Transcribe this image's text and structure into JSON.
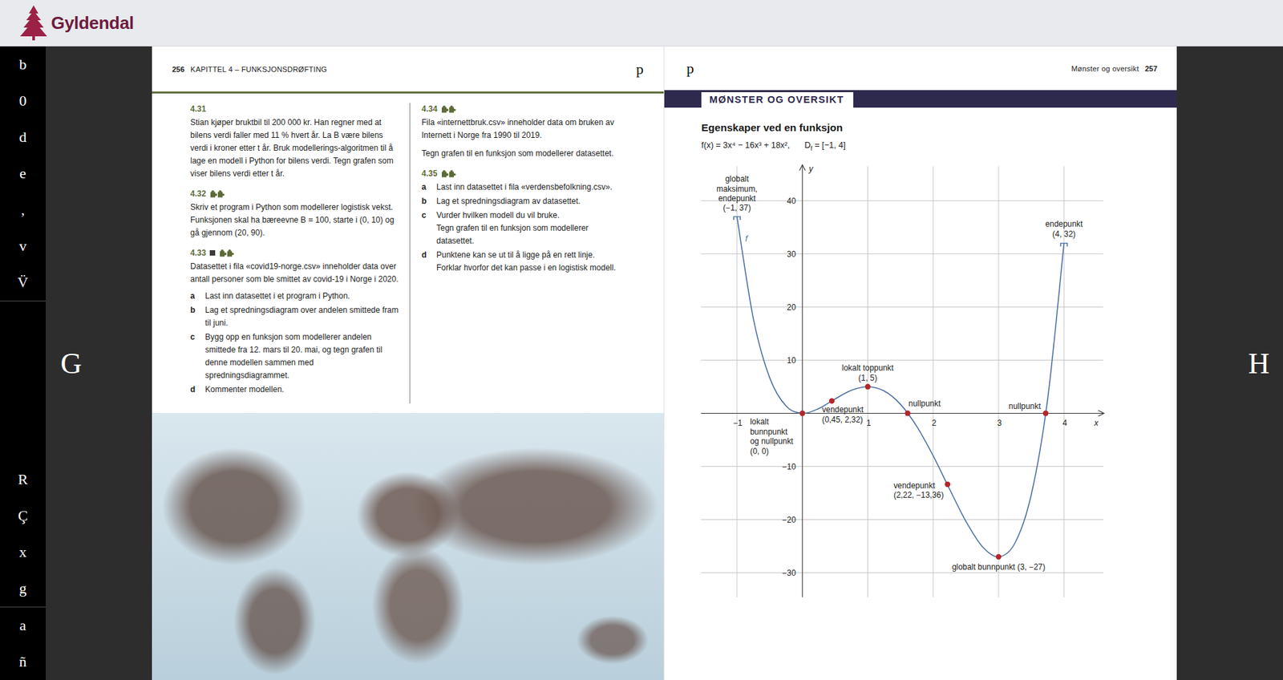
{
  "header": {
    "logo": "Gyldendal"
  },
  "sidebar": {
    "top": [
      "b",
      "0",
      "d",
      "e",
      "‚",
      "v",
      "V̈"
    ],
    "middle": [
      "R",
      "Ç",
      "x",
      "g"
    ],
    "bottom": [
      "a",
      "ñ"
    ]
  },
  "navigation": {
    "previous": "G",
    "next": "H"
  },
  "left_page": {
    "page_number": "256",
    "title": "KAPITTEL 4 – FUNKSJONSDRØFTING",
    "marker": "p",
    "exercises": {
      "left": [
        {
          "number": "4.31",
          "square": false,
          "puzzle": false,
          "paragraphs": [
            "Stian kjøper bruktbil til 200 000 kr. Han regner med at bilens verdi faller med 11 % hvert år. La B være bilens verdi i kroner etter t år. Bruk modellerings-algoritmen til å lage en modell i Python for bilens verdi. Tegn grafen som viser bilens verdi etter t år."
          ],
          "parts": []
        },
        {
          "number": "4.32",
          "square": false,
          "puzzle": true,
          "paragraphs": [
            "Skriv et program i Python som modellerer logistisk vekst. Funksjonen skal ha bæreevne B = 100, starte i (0, 10) og gå gjennom (20, 90)."
          ],
          "parts": []
        },
        {
          "number": "4.33",
          "square": true,
          "puzzle": true,
          "paragraphs": [
            "Datasettet i fila «covid19-norge.csv» inneholder data over antall personer som ble smittet av covid-19 i Norge i 2020."
          ],
          "parts": [
            {
              "label": "a",
              "lines": [
                "Last inn datasettet i et program i Python."
              ]
            },
            {
              "label": "b",
              "lines": [
                "Lag et spredningsdiagram over andelen smittede fram til juni."
              ]
            },
            {
              "label": "c",
              "lines": [
                "Bygg opp en funksjon som modellerer andelen smittede fra 12. mars til 20. mai, og tegn grafen til denne modellen sammen med spredningsdiagrammet."
              ]
            },
            {
              "label": "d",
              "lines": [
                "Kommenter modellen."
              ]
            }
          ]
        }
      ],
      "right": [
        {
          "number": "4.34",
          "square": false,
          "puzzle": true,
          "paragraphs": [
            "Fila «internettbruk.csv» inneholder data om bruken av Internett i Norge fra 1990 til 2019.",
            "Tegn grafen til en funksjon som modellerer datasettet."
          ],
          "parts": []
        },
        {
          "number": "4.35",
          "square": false,
          "puzzle": true,
          "paragraphs": [],
          "parts": [
            {
              "label": "a",
              "lines": [
                "Last inn datasettet i fila «verdensbefolkning.csv»."
              ]
            },
            {
              "label": "b",
              "lines": [
                "Lag et spredningsdiagram av datasettet."
              ]
            },
            {
              "label": "c",
              "lines": [
                "Vurder hvilken modell du vil bruke.",
                "Tegn grafen til en funksjon som modellerer datasettet."
              ]
            },
            {
              "label": "d",
              "lines": [
                "Punktene kan se ut til å ligge på en rett linje. Forklar hvorfor det kan passe i en logistisk modell."
              ]
            }
          ]
        }
      ]
    }
  },
  "right_page": {
    "marker": "p",
    "title": "Mønster og oversikt",
    "page_number": "257",
    "band": "MØNSTER OG OVERSIKT",
    "heading": "Egenskaper ved en funksjon",
    "formula": {
      "function": "f(x) = 3x⁴ − 16x³ + 18x²,",
      "domain_symbol": "D",
      "domain_sub": "f",
      "domain_value": "= [−1, 4]"
    },
    "chart": {
      "x_label": "x",
      "y_label": "y",
      "x_ticks": [
        {
          "value": -1,
          "label": "−1"
        },
        {
          "value": 1,
          "label": "1"
        },
        {
          "value": 2,
          "label": "2"
        },
        {
          "value": 3,
          "label": "3"
        },
        {
          "value": 4,
          "label": "4"
        }
      ],
      "y_ticks": [
        {
          "value": 40,
          "label": "40"
        },
        {
          "value": 30,
          "label": "30"
        },
        {
          "value": 20,
          "label": "20"
        },
        {
          "value": 10,
          "label": "10"
        },
        {
          "value": -10,
          "label": "−10"
        },
        {
          "value": -20,
          "label": "−20"
        },
        {
          "value": -30,
          "label": "−30"
        }
      ],
      "series": [
        {
          "name": "f",
          "x": [
            -1,
            -0.75,
            -0.5,
            -0.25,
            0,
            0.25,
            0.5,
            0.75,
            1,
            1.25,
            1.5,
            1.75,
            2,
            2.25,
            2.5,
            2.75,
            3,
            3.25,
            3.5,
            3.75,
            4
          ],
          "y": [
            37,
            17.824,
            6.688,
            1.387,
            0,
            0.887,
            2.688,
            4.324,
            5,
            4.199,
            1.688,
            -2.488,
            -8,
            -14.238,
            -20.313,
            -25.051,
            -27,
            -24.426,
            -15.313,
            2.637,
            32
          ]
        }
      ],
      "marks": [
        {
          "kind": "endpoint",
          "x": -1,
          "y": 37,
          "label": [
            "globalt",
            "maksimum,",
            "endepunkt",
            "(−1, 37)"
          ]
        },
        {
          "kind": "endpoint",
          "x": 4,
          "y": 32,
          "label": [
            "endepunkt",
            "(4, 32)"
          ]
        },
        {
          "kind": "dot",
          "x": 1,
          "y": 5,
          "label": [
            "lokalt toppunkt",
            "(1, 5)"
          ]
        },
        {
          "kind": "dot",
          "x": 0.45,
          "y": 2.32,
          "label": [
            "vendepunkt",
            "(0,45, 2,32)"
          ]
        },
        {
          "kind": "dot",
          "x": 1.61,
          "y": 0,
          "label": [
            "nullpunkt"
          ]
        },
        {
          "kind": "dot",
          "x": 3.72,
          "y": 0,
          "label": [
            "nullpunkt"
          ]
        },
        {
          "kind": "dot",
          "x": 0,
          "y": 0,
          "label": [
            "lokalt",
            "bunnpunkt",
            "og nullpunkt",
            "(0, 0)"
          ]
        },
        {
          "kind": "dot",
          "x": 2.22,
          "y": -13.36,
          "label": [
            "vendepunkt",
            "(2,22, −13,36)"
          ]
        },
        {
          "kind": "dot",
          "x": 3,
          "y": -27,
          "label": [
            "globalt bunnpunkt (3, −27)"
          ]
        }
      ]
    }
  }
}
